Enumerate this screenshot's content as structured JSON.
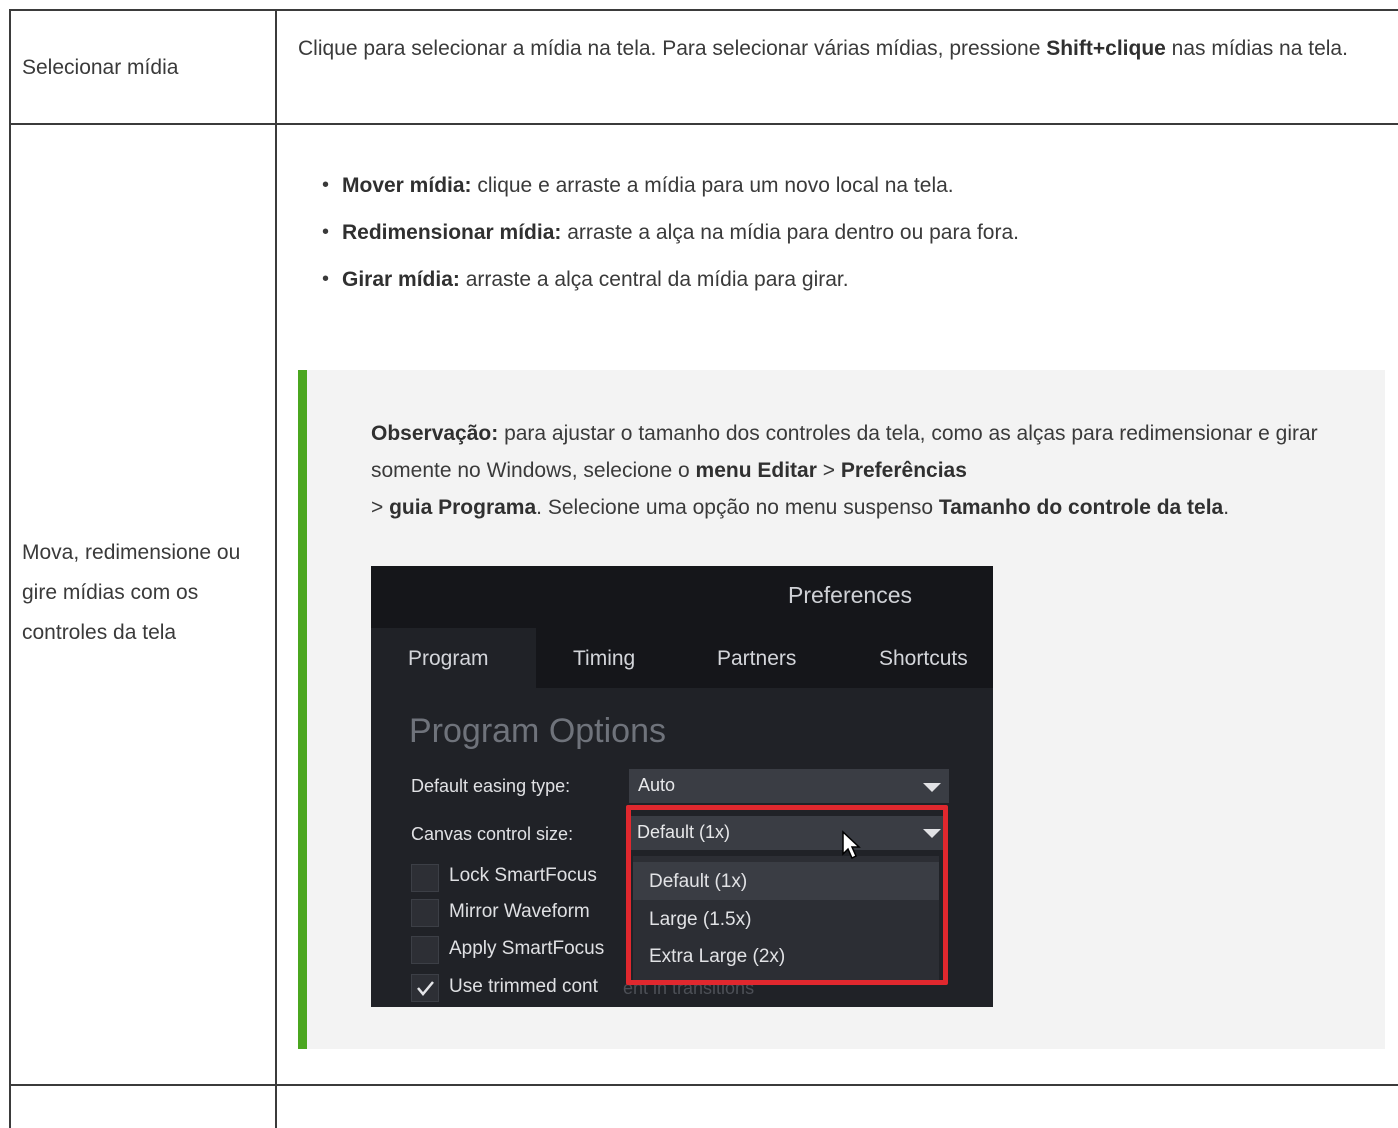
{
  "rows": [
    {
      "label": "Selecionar mídia",
      "desc_part1": "Clique para selecionar a mídia na tela. Para selecionar várias mídias, pressione ",
      "desc_bold": "Shift+clique",
      "desc_part2": " nas mídias na tela."
    },
    {
      "label": "Mova, redimensione ou gire mídias com os controles da tela",
      "bullets": [
        {
          "bold": "Mover mídia:",
          "text": " clique e arraste a mídia para um novo local na tela."
        },
        {
          "bold": "Redimensionar mídia:",
          "text": " arraste a alça na mídia para dentro ou para fora."
        },
        {
          "bold": "Girar mídia:",
          "text": " arraste a alça central da mídia para girar."
        }
      ],
      "note": {
        "bold1": "Observação:",
        "t1": " para ajustar o tamanho dos controles da tela, como as alças para redimensionar e girar somente no Windows, selecione o ",
        "bold2": "menu Editar",
        "t2": " > ",
        "bold3": "Preferências",
        "t3": " > ",
        "bold4": "guia Programa",
        "t4": ". Selecione uma opção no menu suspenso ",
        "bold5": "Tamanho do controle da tela",
        "t5": "."
      },
      "screenshot": {
        "title": "Preferences",
        "tabs": [
          "Program",
          "Timing",
          "Partners",
          "Shortcuts"
        ],
        "heading": "Program Options",
        "easing_label": "Default easing type:",
        "easing_value": "Auto",
        "canvas_label": "Canvas control size:",
        "canvas_value": "Default (1x)",
        "checkboxes": [
          "Lock SmartFocus",
          "Mirror Waveform",
          "Apply SmartFocus",
          "Use trimmed cont"
        ],
        "hidden_text": "ent in transitions",
        "menu_options": [
          "Default (1x)",
          "Large (1.5x)",
          "Extra Large (2x)"
        ],
        "colors": {
          "highlight": "#e0282e",
          "note_bar": "#4aa61f"
        }
      }
    }
  ]
}
